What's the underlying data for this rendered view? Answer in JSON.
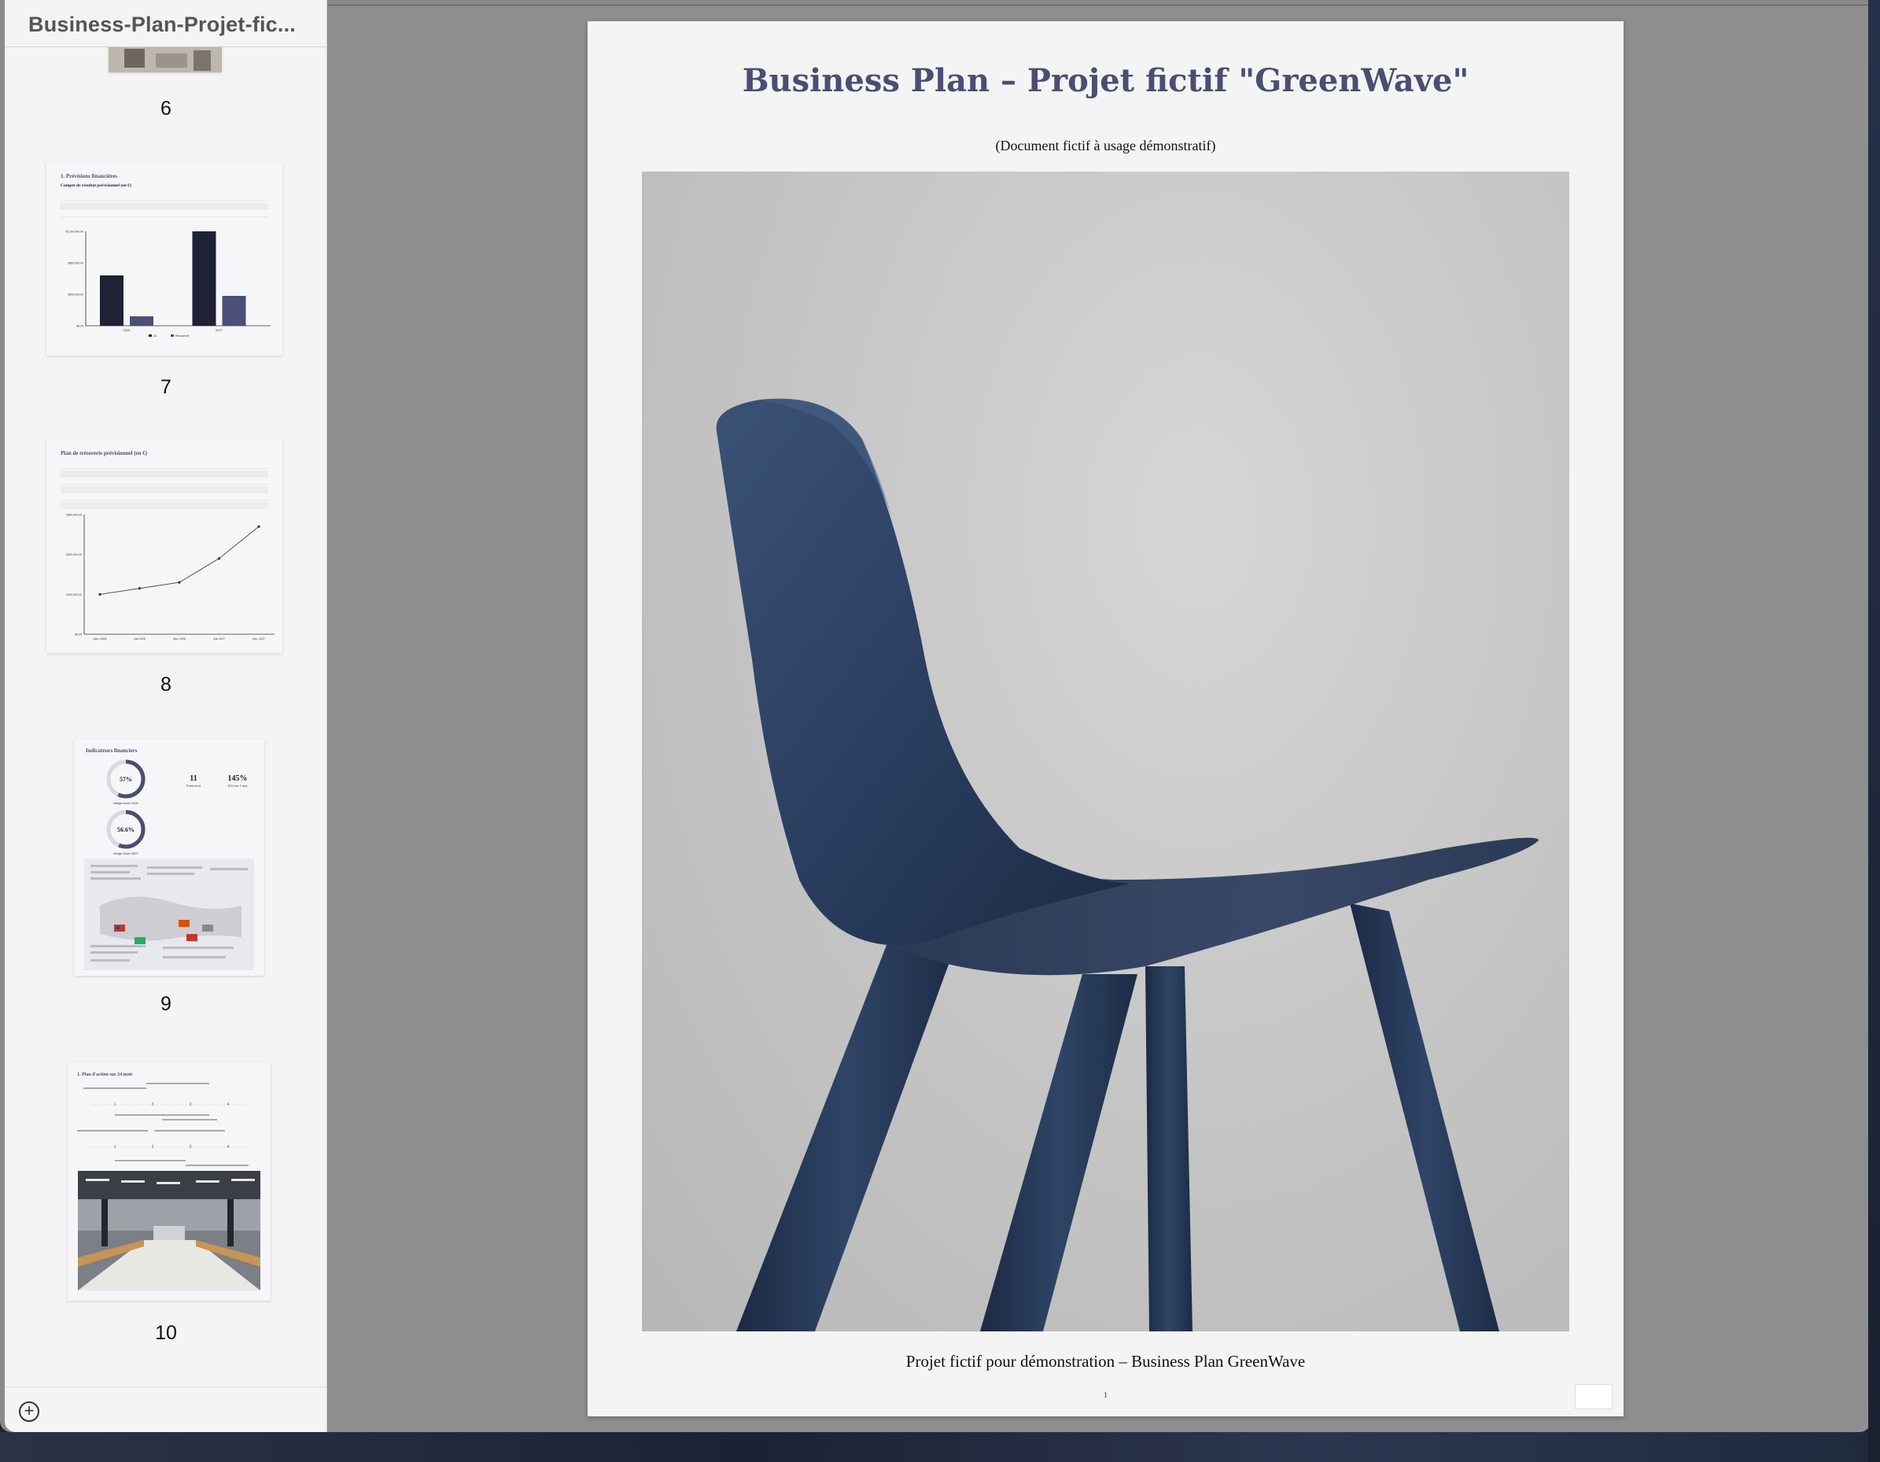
{
  "window": {
    "sidebar_title": "Business-Plan-Projet-fic..."
  },
  "sidebar": {
    "pages": [
      {
        "number": "6"
      },
      {
        "number": "7",
        "title": "1. Prévisions financières",
        "subtitle": "Compte de résultat prévisionnel (en €)",
        "chart": {
          "type": "bar",
          "categories": [
            "2026",
            "2027"
          ],
          "series": [
            {
              "name": "CA",
              "values": [
                640000,
                1200000
              ]
            },
            {
              "name": "Résultat net",
              "values": [
                120000,
                380000
              ]
            }
          ],
          "ylim": [
            0,
            1200000
          ],
          "ticks": [
            "$0.00",
            "$400,000.00",
            "$800,000.00",
            "$1,200,000.00"
          ]
        }
      },
      {
        "number": "8",
        "title": "Plan de trésorerie prévisionnel (en €)",
        "chart": {
          "type": "line",
          "categories": [
            "Janv. 2026",
            "Juin 2026",
            "Déc. 2026",
            "Juin 2027",
            "Déc. 2027"
          ],
          "values": [
            100000,
            115000,
            130000,
            190000,
            270000
          ],
          "ylim": [
            0,
            300000
          ],
          "ticks": [
            "$0.00",
            "$100,000.00",
            "$200,000.00",
            "$300,000.00"
          ]
        }
      },
      {
        "number": "9",
        "title": "Indicateurs financiers",
        "kpis": [
          {
            "value": "57%",
            "label": "Marge brute 2026"
          },
          {
            "value": "56.6%",
            "label": "Marge brute 2027"
          },
          {
            "value": "11",
            "label": "Point mort"
          },
          {
            "value": "145%",
            "label": "ROI sur 2 ans"
          }
        ]
      },
      {
        "number": "10",
        "title": "1. Plan d'action sur 24 mois"
      }
    ],
    "add_page_label": "+"
  },
  "document": {
    "title": "Business Plan – Projet fictif \"GreenWave\"",
    "subtitle": "(Document fictif à usage démonstratif)",
    "caption": "Projet fictif pour démonstration – Business Plan GreenWave",
    "page_number": "1"
  },
  "colors": {
    "title_navy": "#4a4e73",
    "chair_blue": "#2c3e5c",
    "bar_dark": "#1f2235",
    "bar_light": "#4b5078"
  }
}
